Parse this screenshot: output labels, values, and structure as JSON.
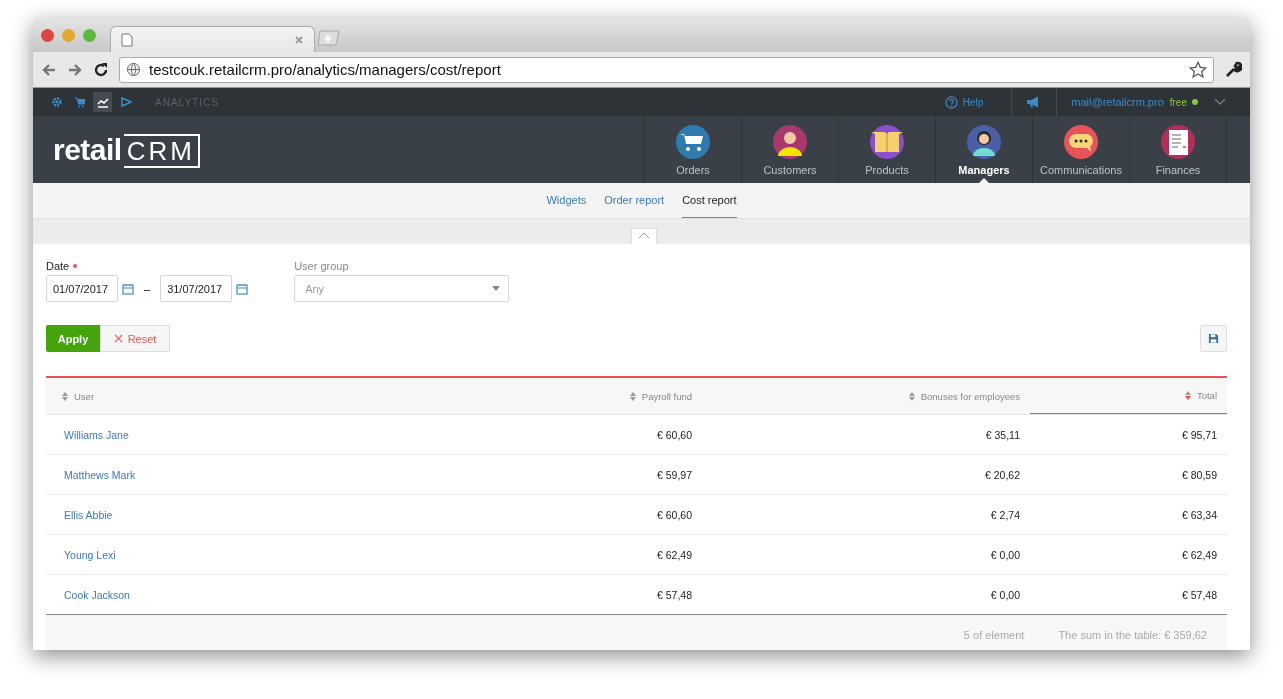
{
  "browser": {
    "url": "testcouk.retailcrm.pro/analytics/managers/cost/report"
  },
  "topbar": {
    "modules": [
      {
        "kind": "settings",
        "selected": false
      },
      {
        "kind": "cart",
        "selected": false
      },
      {
        "kind": "chart",
        "selected": true
      },
      {
        "kind": "play",
        "selected": false
      }
    ],
    "section": "ANALYTICS",
    "help": "Help",
    "email": "mail@retailcrm.pro",
    "plan": "free"
  },
  "logo": {
    "part_1": "retail",
    "part_2": "CRM"
  },
  "nav": [
    {
      "kind": "cart",
      "label": "Orders",
      "selected": false
    },
    {
      "kind": "customer",
      "label": "Customers",
      "selected": false
    },
    {
      "kind": "box",
      "label": "Products",
      "selected": false
    },
    {
      "kind": "manager",
      "label": "Managers",
      "selected": true
    },
    {
      "kind": "chat",
      "label": "Communications",
      "selected": false
    },
    {
      "kind": "document",
      "label": "Finances",
      "selected": false
    }
  ],
  "subnav": [
    {
      "label": "Widgets",
      "selected": false
    },
    {
      "label": "Order report",
      "selected": false
    },
    {
      "label": "Cost report",
      "selected": true
    }
  ],
  "filters": {
    "date_label": "Date",
    "date_required": true,
    "date_from": "01/07/2017",
    "date_separator": "–",
    "date_to": "31/07/2017",
    "group_label": "User group",
    "group_placeholder": "Any"
  },
  "buttons": {
    "apply": "Apply",
    "reset": "Reset"
  },
  "table": {
    "columns": [
      {
        "label": "User",
        "sorted": false
      },
      {
        "label": "Payroll fund",
        "sorted": false
      },
      {
        "label": "Bonuses for employees",
        "sorted": false
      },
      {
        "label": "Total",
        "sorted": true
      }
    ],
    "rows": [
      [
        "Williams Jane",
        "€ 60,60",
        "€ 35,11",
        "€ 95,71"
      ],
      [
        "Matthews Mark",
        "€ 59,97",
        "€ 20,62",
        "€ 80,59"
      ],
      [
        "Ellis Abbie",
        "€ 60,60",
        "€ 2,74",
        "€ 63,34"
      ],
      [
        "Young Lexi",
        "€ 62,49",
        "€ 0,00",
        "€ 62,49"
      ],
      [
        "Cook Jackson",
        "€ 57,48",
        "€ 0,00",
        "€ 57,48"
      ]
    ],
    "count": "5 of element",
    "sum": "The sum in the table: € 359,62"
  }
}
